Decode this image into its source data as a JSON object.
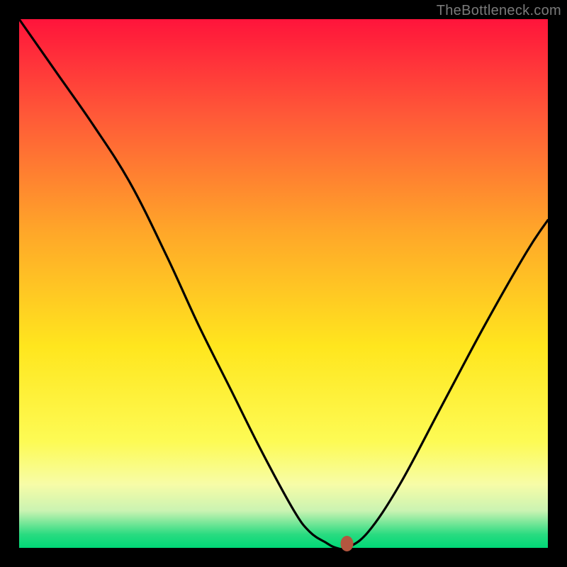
{
  "watermark": "TheBottleneck.com",
  "chart_data": {
    "type": "line",
    "title": "",
    "xlabel": "",
    "ylabel": "",
    "xlim": [
      0,
      100
    ],
    "ylim": [
      0,
      100
    ],
    "x": [
      0,
      7,
      14,
      21,
      28,
      34,
      40,
      46,
      52,
      55,
      58,
      60,
      62,
      66,
      72,
      80,
      88,
      96,
      100
    ],
    "values": [
      100,
      90,
      80,
      69,
      55,
      42,
      30,
      18,
      7,
      3,
      1,
      0,
      0,
      3,
      12,
      27,
      42,
      56,
      62
    ],
    "marker": {
      "x": 62,
      "y": 0,
      "color": "#b4563f"
    },
    "gradient_stops": [
      {
        "pos": 0,
        "color": "#ff143b"
      },
      {
        "pos": 0.4,
        "color": "#ffa629"
      },
      {
        "pos": 0.62,
        "color": "#ffe61e"
      },
      {
        "pos": 0.93,
        "color": "#caf3b2"
      },
      {
        "pos": 1.0,
        "color": "#00d877"
      }
    ]
  }
}
